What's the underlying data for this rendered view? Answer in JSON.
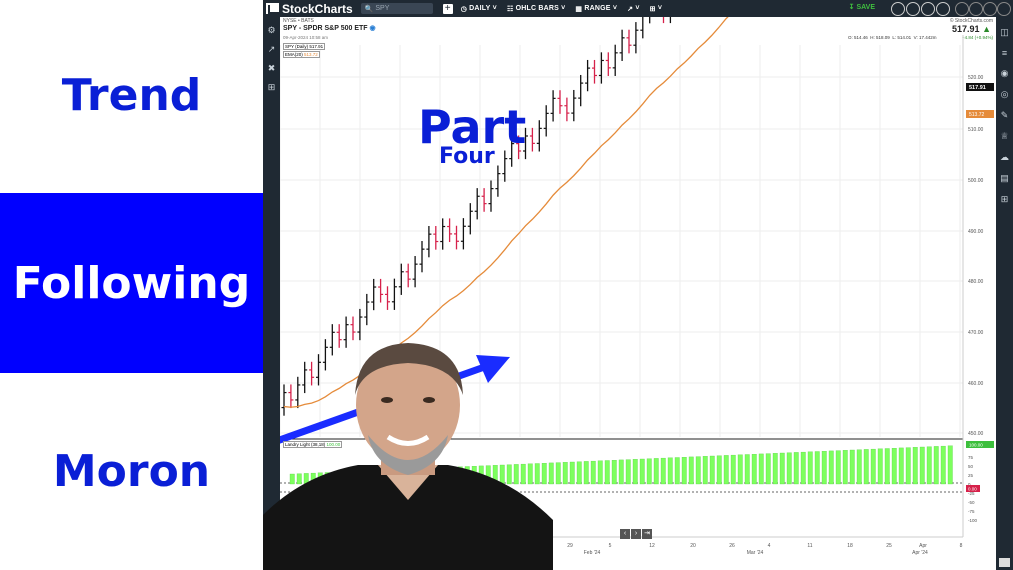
{
  "thumbnail": {
    "title_line1": "Trend",
    "title_line2": "Following",
    "title_line3": "Moron",
    "overlay_part": "Part",
    "overlay_four": "Four",
    "colors": {
      "blue_text": "#0a1fd6",
      "blue_band": "#0000ff",
      "arrow": "#1a2cff"
    }
  },
  "toolbar": {
    "brand": "StockCharts",
    "search_placeholder": "SPY",
    "period": "DAILY",
    "chart_style": "OHLC BARS",
    "range": "RANGE",
    "save": "SAVE"
  },
  "header": {
    "exchange": "NYSE • BATS",
    "symbol_title": "SPY - SPDR S&P 500 ETF",
    "timestamp": "09-Apr-2024 10:58 am",
    "copyright": "© StockCharts.com",
    "last_price": "517.91",
    "change": "+4.84 (+0.94%)",
    "open": "O: 514.46",
    "high": "H: 518.09",
    "low": "L: 514.01",
    "volume": "V: 17.442m"
  },
  "legend": {
    "main": "SPY (Daily) 517.91",
    "ema_label": "EMA(20)",
    "ema_value": "513.72",
    "lower_label": "Landry Light (38,18)",
    "lower_value": "100.00"
  },
  "chart_data": {
    "type": "ohlc",
    "y_ticks": [
      "520.00",
      "510.00",
      "500.00",
      "490.00",
      "480.00",
      "470.00",
      "460.00",
      "450.00"
    ],
    "price_badge": "517.91",
    "ema_badge": "513.72",
    "lower_ticks": [
      "75",
      "50",
      "25",
      "0",
      "-25",
      "-50",
      "-75",
      "-100"
    ],
    "lower_badge_top": "100.00",
    "lower_badge_zero": "0.00",
    "x_ticks": [
      "29",
      "5",
      "12",
      "20",
      "26",
      "4",
      "11",
      "18",
      "25",
      "Apr",
      "8"
    ],
    "x_month_labels": [
      "Feb '24",
      "Mar '24",
      "Apr '24"
    ],
    "colors": {
      "up": "#111111",
      "down": "#d6214a",
      "ema": "#e58b3a",
      "histogram": "#7dff5e"
    }
  }
}
